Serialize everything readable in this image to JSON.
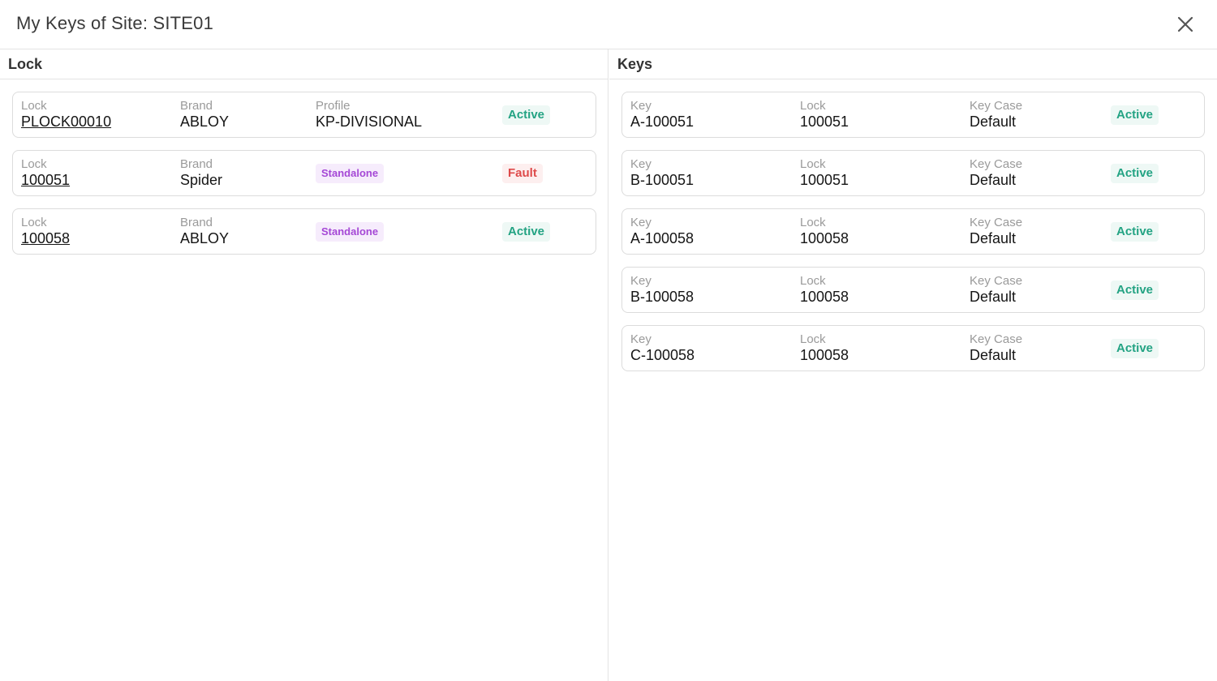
{
  "dialog": {
    "title": "My Keys of Site: SITE01",
    "close_icon": "close-icon"
  },
  "lock_panel": {
    "title": "Lock",
    "cards": [
      {
        "lock_label": "Lock",
        "lock": "PLOCK00010",
        "brand_label": "Brand",
        "brand": "ABLOY",
        "profile_label": "Profile",
        "profile": "KP-DIVISIONAL",
        "status": "Active"
      },
      {
        "lock_label": "Lock",
        "lock": "100051",
        "brand_label": "Brand",
        "brand": "Spider",
        "profile_badge": "Standalone",
        "status": "Fault"
      },
      {
        "lock_label": "Lock",
        "lock": "100058",
        "brand_label": "Brand",
        "brand": "ABLOY",
        "profile_badge": "Standalone",
        "status": "Active"
      }
    ]
  },
  "keys_panel": {
    "title": "Keys",
    "cards": [
      {
        "key_label": "Key",
        "key": "A-100051",
        "lock_label": "Lock",
        "lock": "100051",
        "case_label": "Key Case",
        "case": "Default",
        "status": "Active"
      },
      {
        "key_label": "Key",
        "key": "B-100051",
        "lock_label": "Lock",
        "lock": "100051",
        "case_label": "Key Case",
        "case": "Default",
        "status": "Active"
      },
      {
        "key_label": "Key",
        "key": "A-100058",
        "lock_label": "Lock",
        "lock": "100058",
        "case_label": "Key Case",
        "case": "Default",
        "status": "Active"
      },
      {
        "key_label": "Key",
        "key": "B-100058",
        "lock_label": "Lock",
        "lock": "100058",
        "case_label": "Key Case",
        "case": "Default",
        "status": "Active"
      },
      {
        "key_label": "Key",
        "key": "C-100058",
        "lock_label": "Lock",
        "lock": "100058",
        "case_label": "Key Case",
        "case": "Default",
        "status": "Active"
      }
    ]
  },
  "colors": {
    "active": "#23a383",
    "fault": "#de4a4a",
    "standalone": "#a548d6",
    "border": "#dcdcdc"
  }
}
